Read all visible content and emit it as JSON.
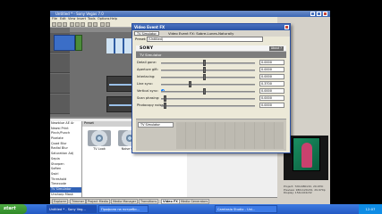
{
  "app": {
    "title": "Untitled * - Sony Vegas 7.0",
    "menu": [
      "File",
      "Edit",
      "View",
      "Insert",
      "Tools",
      "Options",
      "Help"
    ]
  },
  "left_list": {
    "items": [
      "Newblue AE Ar",
      "Newsi Print",
      "Pinch/Punch",
      "Pixelate",
      "Quad Blur",
      "Radial Blur",
      "Saturation Adj",
      "Sepia",
      "Sharpen",
      "Soften",
      "Swirl",
      "Threshold",
      "Timecode",
      "TV Simulator",
      "Unsharp Mask",
      "Wave"
    ],
    "selected_index": 13
  },
  "presets_panel": {
    "label": "Preset",
    "thumbs": [
      "TV Look",
      "Noise Only"
    ]
  },
  "bottom_tabs": {
    "items": [
      "Explorer",
      "Trimmer",
      "Project Media",
      "Media Manager",
      "Transitions",
      "Video FX",
      "Media Generators"
    ],
    "active_index": 5
  },
  "preview": {
    "info_lines": [
      "Project: 720x480x32, 29.970i",
      "Preview: 180x120x32, 29.970p",
      "Display: 154x104x32",
      "Frame: 762"
    ]
  },
  "vfx_dialog": {
    "title": "Video Event FX",
    "chip_label": "TV Simulator",
    "header_text": "Video Event FX: Sobre-Lunes-Naturally",
    "preset_label": "Preset:",
    "preset_value": "(Untitled)",
    "brand": "SONY",
    "about_label": "About ?",
    "fx_name": "TV Simulator",
    "params": [
      {
        "label": "Detail gone:",
        "value": "0.0000",
        "level": 0.45
      },
      {
        "label": "Aperture gift:",
        "value": "0.0000",
        "level": 0.45
      },
      {
        "label": "Interlacing:",
        "value": "0.0000",
        "level": 0.45
      },
      {
        "label": "Line sync:",
        "value": "0.3700",
        "level": 0.3
      },
      {
        "label": "Vertical sync:",
        "value": "0.0000",
        "level": 0.45
      },
      {
        "label": "Scan phasing:",
        "value": "0.0000",
        "level": 0.05
      },
      {
        "label": "Photocopy noise:",
        "value": "0.0000",
        "level": 0.05
      }
    ],
    "chain_item": "TV Simulator"
  },
  "taskbar": {
    "start": "start",
    "tasks": [
      "Untitled * - Sony Veg...",
      "Профиля на потреби...",
      "Camtasia Studio - Uni..."
    ],
    "active_task_index": 0,
    "clock": "12:07"
  }
}
